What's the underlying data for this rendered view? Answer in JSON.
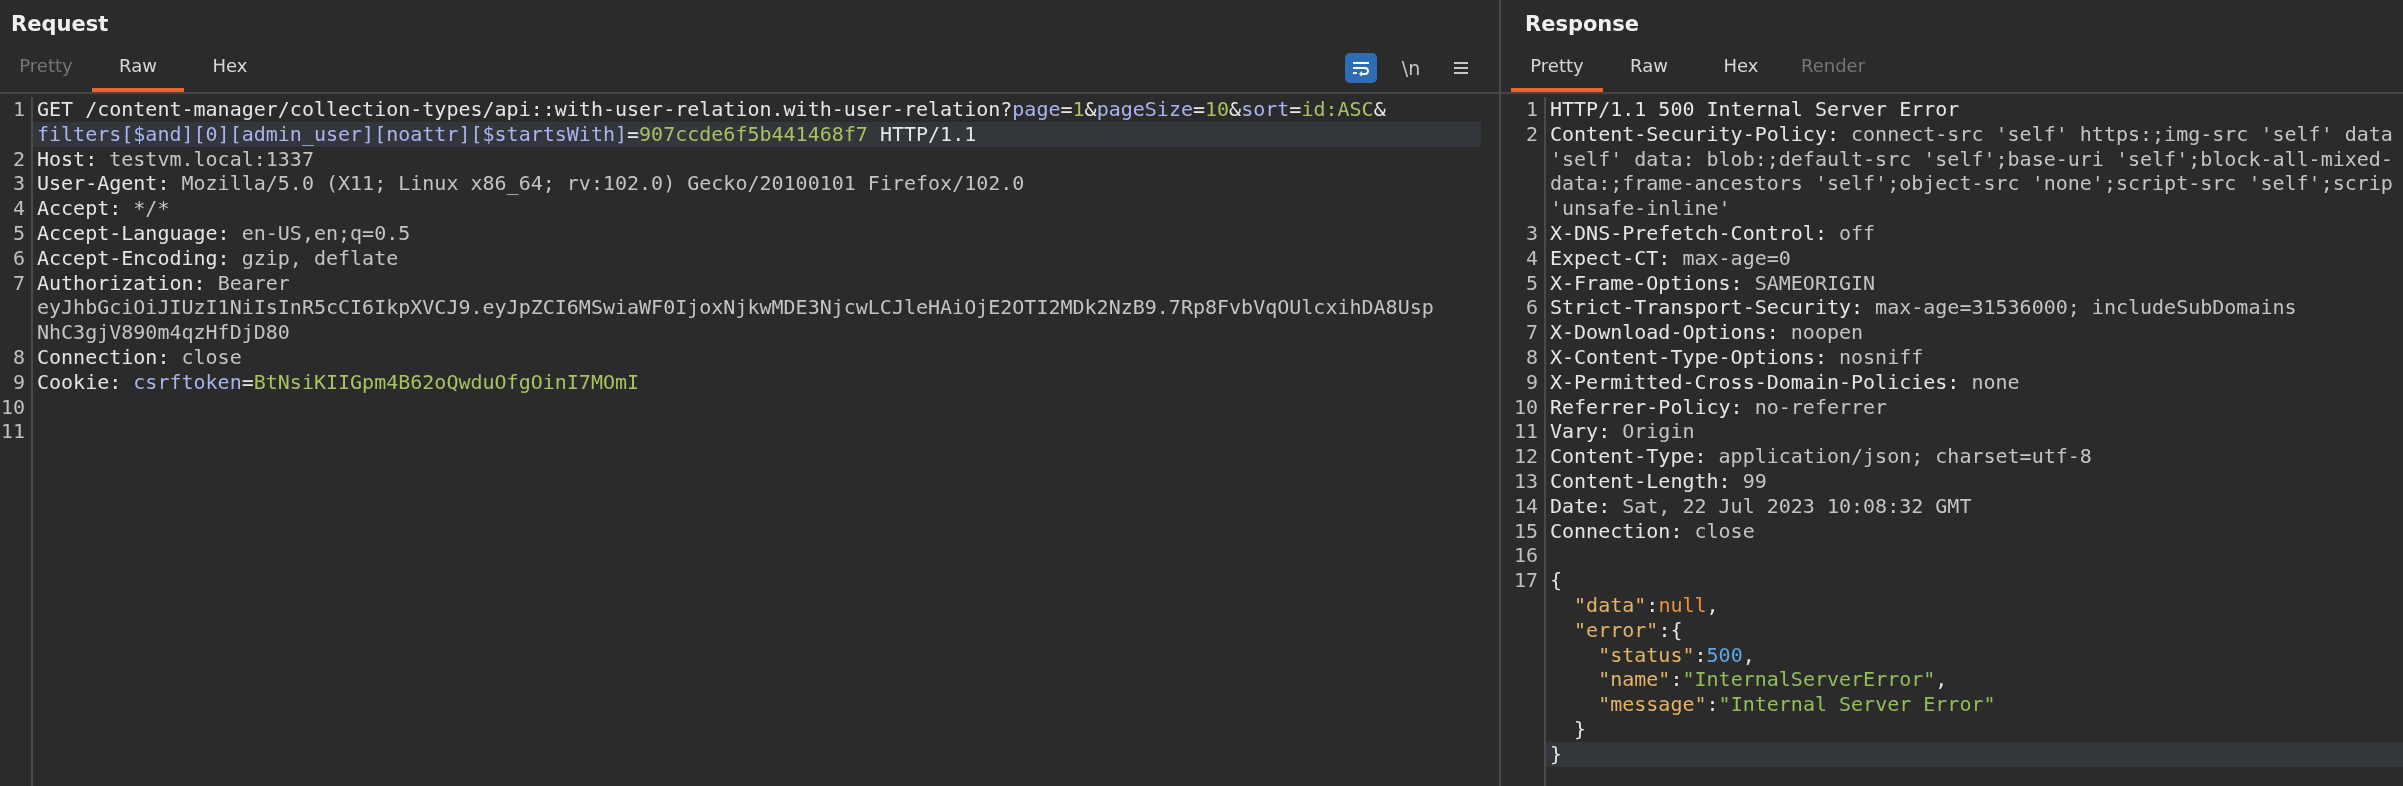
{
  "request": {
    "title": "Request",
    "tabs": [
      {
        "label": "Pretty",
        "selected": false,
        "disabled": true
      },
      {
        "label": "Raw",
        "selected": true,
        "disabled": false
      },
      {
        "label": "Hex",
        "selected": false,
        "disabled": false
      }
    ],
    "toolbar": [
      {
        "kind": "wrap",
        "on": true
      },
      {
        "kind": "newlines",
        "label": "\\n",
        "on": false
      },
      {
        "kind": "menu"
      }
    ],
    "lines": [
      {
        "number": "1",
        "rows": [
          {
            "current": false,
            "segments": [
              {
                "kind": "key",
                "text": "GET /content-manager/collection-types/api::with-user-relation.with-user-relation?"
              },
              {
                "kind": "param",
                "text": "page"
              },
              {
                "kind": "key",
                "text": "="
              },
              {
                "kind": "pval",
                "text": "1"
              },
              {
                "kind": "key",
                "text": "&"
              },
              {
                "kind": "param",
                "text": "pageSize"
              },
              {
                "kind": "key",
                "text": "="
              },
              {
                "kind": "pval",
                "text": "10"
              },
              {
                "kind": "key",
                "text": "&"
              },
              {
                "kind": "param",
                "text": "sort"
              },
              {
                "kind": "key",
                "text": "="
              },
              {
                "kind": "pval",
                "text": "id:ASC"
              },
              {
                "kind": "key",
                "text": "&"
              }
            ]
          },
          {
            "current": true,
            "segments": [
              {
                "kind": "param",
                "text": "filters[$and][0][admin_user][noattr][$startsWith]"
              },
              {
                "kind": "key",
                "text": "="
              },
              {
                "kind": "pval",
                "text": "907ccde6f5b441468f7"
              },
              {
                "kind": "key",
                "text": " HTTP/1.1"
              }
            ]
          }
        ]
      },
      {
        "number": "2",
        "rows": [
          {
            "current": false,
            "segments": [
              {
                "kind": "key",
                "text": "Host: "
              },
              {
                "kind": "value",
                "text": "testvm.local:1337"
              }
            ]
          }
        ]
      },
      {
        "number": "3",
        "rows": [
          {
            "current": false,
            "segments": [
              {
                "kind": "key",
                "text": "User-Agent: "
              },
              {
                "kind": "value",
                "text": "Mozilla/5.0 (X11; Linux x86_64; rv:102.0) Gecko/20100101 Firefox/102.0"
              }
            ]
          }
        ]
      },
      {
        "number": "4",
        "rows": [
          {
            "current": false,
            "segments": [
              {
                "kind": "key",
                "text": "Accept: "
              },
              {
                "kind": "value",
                "text": "*/*"
              }
            ]
          }
        ]
      },
      {
        "number": "5",
        "rows": [
          {
            "current": false,
            "segments": [
              {
                "kind": "key",
                "text": "Accept-Language: "
              },
              {
                "kind": "value",
                "text": "en-US,en;q=0.5"
              }
            ]
          }
        ]
      },
      {
        "number": "6",
        "rows": [
          {
            "current": false,
            "segments": [
              {
                "kind": "key",
                "text": "Accept-Encoding: "
              },
              {
                "kind": "value",
                "text": "gzip, deflate"
              }
            ]
          }
        ]
      },
      {
        "number": "7",
        "rows": [
          {
            "current": false,
            "segments": [
              {
                "kind": "key",
                "text": "Authorization: "
              },
              {
                "kind": "value",
                "text": "Bearer"
              }
            ]
          },
          {
            "current": false,
            "segments": [
              {
                "kind": "value",
                "text": "eyJhbGciOiJIUzI1NiIsInR5cCI6IkpXVCJ9.eyJpZCI6MSwiaWF0IjoxNjkwMDE3NjcwLCJleHAiOjE2OTI2MDk2NzB9.7Rp8FvbVqOUlcxihDA8Usp"
              }
            ]
          },
          {
            "current": false,
            "segments": [
              {
                "kind": "value",
                "text": "NhC3gjV890m4qzHfDjD80"
              }
            ]
          }
        ]
      },
      {
        "number": "8",
        "rows": [
          {
            "current": false,
            "segments": [
              {
                "kind": "key",
                "text": "Connection: "
              },
              {
                "kind": "value",
                "text": "close"
              }
            ]
          }
        ]
      },
      {
        "number": "9",
        "rows": [
          {
            "current": false,
            "segments": [
              {
                "kind": "key",
                "text": "Cookie: "
              },
              {
                "kind": "param",
                "text": "csrftoken"
              },
              {
                "kind": "key",
                "text": "="
              },
              {
                "kind": "pval",
                "text": "BtNsiKIIGpm4B62oQwduOfgOinI7MOmI"
              }
            ]
          }
        ]
      },
      {
        "number": "10",
        "rows": [
          {
            "current": false,
            "segments": []
          }
        ]
      },
      {
        "number": "11",
        "rows": [
          {
            "current": false,
            "segments": []
          }
        ]
      }
    ]
  },
  "response": {
    "title": "Response",
    "tabs": [
      {
        "label": "Pretty",
        "selected": true,
        "disabled": false
      },
      {
        "label": "Raw",
        "selected": false,
        "disabled": false
      },
      {
        "label": "Hex",
        "selected": false,
        "disabled": false
      },
      {
        "label": "Render",
        "selected": false,
        "disabled": true
      }
    ],
    "lines": [
      {
        "number": "1",
        "rows": [
          {
            "current": false,
            "segments": [
              {
                "kind": "key",
                "text": "HTTP/1.1 500 Internal Server Error"
              }
            ]
          }
        ]
      },
      {
        "number": "2",
        "rows": [
          {
            "current": false,
            "segments": [
              {
                "kind": "key",
                "text": "Content-Security-Policy: "
              },
              {
                "kind": "value",
                "text": "connect-src 'self' https:;img-src 'self' data"
              }
            ]
          },
          {
            "current": false,
            "segments": [
              {
                "kind": "value",
                "text": "'self' data: blob:;default-src 'self';base-uri 'self';block-all-mixed-"
              }
            ]
          },
          {
            "current": false,
            "segments": [
              {
                "kind": "value",
                "text": "data:;frame-ancestors 'self';object-src 'none';script-src 'self';scrip"
              }
            ]
          },
          {
            "current": false,
            "segments": [
              {
                "kind": "value",
                "text": "'unsafe-inline'"
              }
            ]
          }
        ]
      },
      {
        "number": "3",
        "rows": [
          {
            "current": false,
            "segments": [
              {
                "kind": "key",
                "text": "X-DNS-Prefetch-Control: "
              },
              {
                "kind": "value",
                "text": "off"
              }
            ]
          }
        ]
      },
      {
        "number": "4",
        "rows": [
          {
            "current": false,
            "segments": [
              {
                "kind": "key",
                "text": "Expect-CT: "
              },
              {
                "kind": "value",
                "text": "max-age=0"
              }
            ]
          }
        ]
      },
      {
        "number": "5",
        "rows": [
          {
            "current": false,
            "segments": [
              {
                "kind": "key",
                "text": "X-Frame-Options: "
              },
              {
                "kind": "value",
                "text": "SAMEORIGIN"
              }
            ]
          }
        ]
      },
      {
        "number": "6",
        "rows": [
          {
            "current": false,
            "segments": [
              {
                "kind": "key",
                "text": "Strict-Transport-Security: "
              },
              {
                "kind": "value",
                "text": "max-age=31536000; includeSubDomains"
              }
            ]
          }
        ]
      },
      {
        "number": "7",
        "rows": [
          {
            "current": false,
            "segments": [
              {
                "kind": "key",
                "text": "X-Download-Options: "
              },
              {
                "kind": "value",
                "text": "noopen"
              }
            ]
          }
        ]
      },
      {
        "number": "8",
        "rows": [
          {
            "current": false,
            "segments": [
              {
                "kind": "key",
                "text": "X-Content-Type-Options: "
              },
              {
                "kind": "value",
                "text": "nosniff"
              }
            ]
          }
        ]
      },
      {
        "number": "9",
        "rows": [
          {
            "current": false,
            "segments": [
              {
                "kind": "key",
                "text": "X-Permitted-Cross-Domain-Policies: "
              },
              {
                "kind": "value",
                "text": "none"
              }
            ]
          }
        ]
      },
      {
        "number": "10",
        "rows": [
          {
            "current": false,
            "segments": [
              {
                "kind": "key",
                "text": "Referrer-Policy: "
              },
              {
                "kind": "value",
                "text": "no-referrer"
              }
            ]
          }
        ]
      },
      {
        "number": "11",
        "rows": [
          {
            "current": false,
            "segments": [
              {
                "kind": "key",
                "text": "Vary: "
              },
              {
                "kind": "value",
                "text": "Origin"
              }
            ]
          }
        ]
      },
      {
        "number": "12",
        "rows": [
          {
            "current": false,
            "segments": [
              {
                "kind": "key",
                "text": "Content-Type: "
              },
              {
                "kind": "value",
                "text": "application/json; charset=utf-8"
              }
            ]
          }
        ]
      },
      {
        "number": "13",
        "rows": [
          {
            "current": false,
            "segments": [
              {
                "kind": "key",
                "text": "Content-Length: "
              },
              {
                "kind": "value",
                "text": "99"
              }
            ]
          }
        ]
      },
      {
        "number": "14",
        "rows": [
          {
            "current": false,
            "segments": [
              {
                "kind": "key",
                "text": "Date: "
              },
              {
                "kind": "value",
                "text": "Sat, 22 Jul 2023 10:08:32 GMT"
              }
            ]
          }
        ]
      },
      {
        "number": "15",
        "rows": [
          {
            "current": false,
            "segments": [
              {
                "kind": "key",
                "text": "Connection: "
              },
              {
                "kind": "value",
                "text": "close"
              }
            ]
          }
        ]
      },
      {
        "number": "16",
        "rows": [
          {
            "current": false,
            "segments": []
          }
        ]
      },
      {
        "number": "17",
        "rows": [
          {
            "current": false,
            "segments": [
              {
                "kind": "key",
                "text": "{"
              }
            ]
          },
          {
            "current": false,
            "segments": [
              {
                "kind": "jkey",
                "text": "  \"data\""
              },
              {
                "kind": "key",
                "text": ":"
              },
              {
                "kind": "jnull",
                "text": "null"
              },
              {
                "kind": "key",
                "text": ","
              }
            ]
          },
          {
            "current": false,
            "segments": [
              {
                "kind": "jkey",
                "text": "  \"error\""
              },
              {
                "kind": "key",
                "text": ":{"
              }
            ]
          },
          {
            "current": false,
            "segments": [
              {
                "kind": "jkey",
                "text": "    \"status\""
              },
              {
                "kind": "key",
                "text": ":"
              },
              {
                "kind": "jnum",
                "text": "500"
              },
              {
                "kind": "key",
                "text": ","
              }
            ]
          },
          {
            "current": false,
            "segments": [
              {
                "kind": "jkey",
                "text": "    \"name\""
              },
              {
                "kind": "key",
                "text": ":"
              },
              {
                "kind": "jstr",
                "text": "\"InternalServerError\""
              },
              {
                "kind": "key",
                "text": ","
              }
            ]
          },
          {
            "current": false,
            "segments": [
              {
                "kind": "jkey",
                "text": "    \"message\""
              },
              {
                "kind": "key",
                "text": ":"
              },
              {
                "kind": "jstr",
                "text": "\"Internal Server Error\""
              }
            ]
          },
          {
            "current": false,
            "segments": [
              {
                "kind": "key",
                "text": "  }"
              }
            ]
          },
          {
            "current": true,
            "segments": [
              {
                "kind": "key",
                "text": "}"
              }
            ]
          }
        ]
      }
    ]
  }
}
